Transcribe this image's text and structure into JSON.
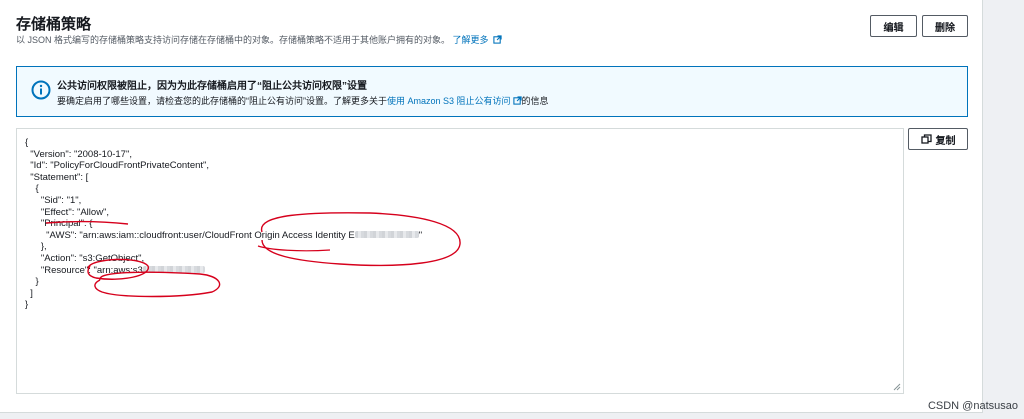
{
  "header": {
    "title": "存储桶策略",
    "description": "以 JSON 格式编写的存储桶策略支持访问存储在存储桶中的对象。存储桶策略不适用于其他账户拥有的对象。",
    "learn_more": "了解更多",
    "edit_label": "编辑",
    "delete_label": "删除"
  },
  "alert": {
    "title": "公共访问权限被阻止，因为为此存储桶启用了“阻止公共访问权限”设置",
    "body_prefix": "要确定启用了哪些设置，请检查您的此存储桶的“阻止公有访问”设置。了解更多关于",
    "body_link": "使用 Amazon S3 阻止公有访问",
    "body_suffix": "的信息"
  },
  "editor": {
    "copy_label": "复制",
    "lines": {
      "l1": "{",
      "l2": "  \"Version\": \"2008-10-17\",",
      "l3": "  \"Id\": \"PolicyForCloudFrontPrivateContent\",",
      "l4": "  \"Statement\": [",
      "l5": "    {",
      "l6": "      \"Sid\": \"1\",",
      "l7": "      \"Effect\": \"Allow\",",
      "l8": "      \"Principal\": {",
      "l9a": "        \"AWS\": \"arn:aws:iam::cloudfront:user/CloudFront Origin Access Identity E",
      "l9b": "\"",
      "l10": "      },",
      "l11": "      \"Action\": \"s3:GetObject\",",
      "l12a": "      \"Resource\": \"arn:aws:s3",
      "l13": "    }",
      "l14": "  ]",
      "l15": "}"
    }
  },
  "watermark": "CSDN @natsusao",
  "colors": {
    "link": "#0073bb",
    "alert_border": "#0073bb",
    "alert_bg": "#f1faff",
    "annotation": "#d6001c"
  }
}
